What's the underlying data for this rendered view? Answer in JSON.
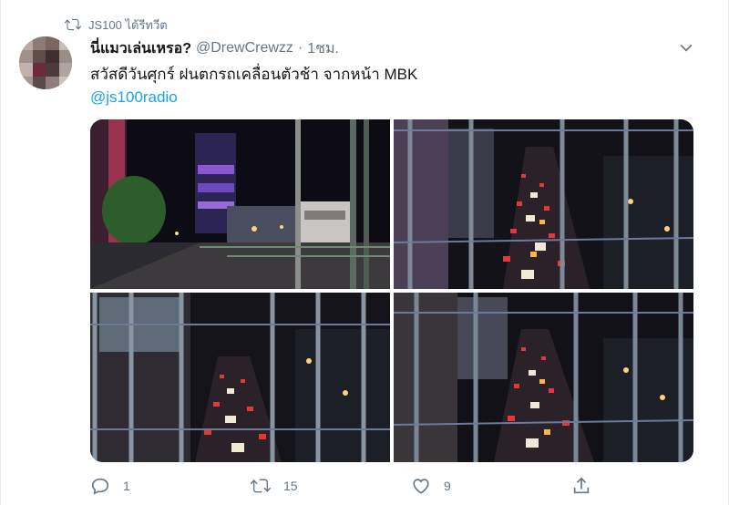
{
  "retweet": {
    "text": "JS100 ได้รีทวีต",
    "icon": "retweet-icon"
  },
  "tweet": {
    "display_name": "นี่แมวเล่นเหรอ?",
    "handle": "@DrewCrewzz",
    "separator": "·",
    "time": "1ชม.",
    "text": "สวัสดีวันศุกร์ ฝนตกรถเคลื่อนตัวช้า จากหน้า MBK",
    "mention": "@js100radio"
  },
  "media": {
    "photos": [
      {
        "name": "photo-1",
        "scene": "street-night-tower"
      },
      {
        "name": "photo-2",
        "scene": "traffic-through-railing"
      },
      {
        "name": "photo-3",
        "scene": "traffic-through-railing-left"
      },
      {
        "name": "photo-4",
        "scene": "traffic-through-railing-right"
      }
    ]
  },
  "actions": {
    "reply_count": "1",
    "retweet_count": "15",
    "like_count": "9"
  },
  "colors": {
    "accent": "#1da1f2",
    "muted": "#657786",
    "text": "#14171a"
  }
}
